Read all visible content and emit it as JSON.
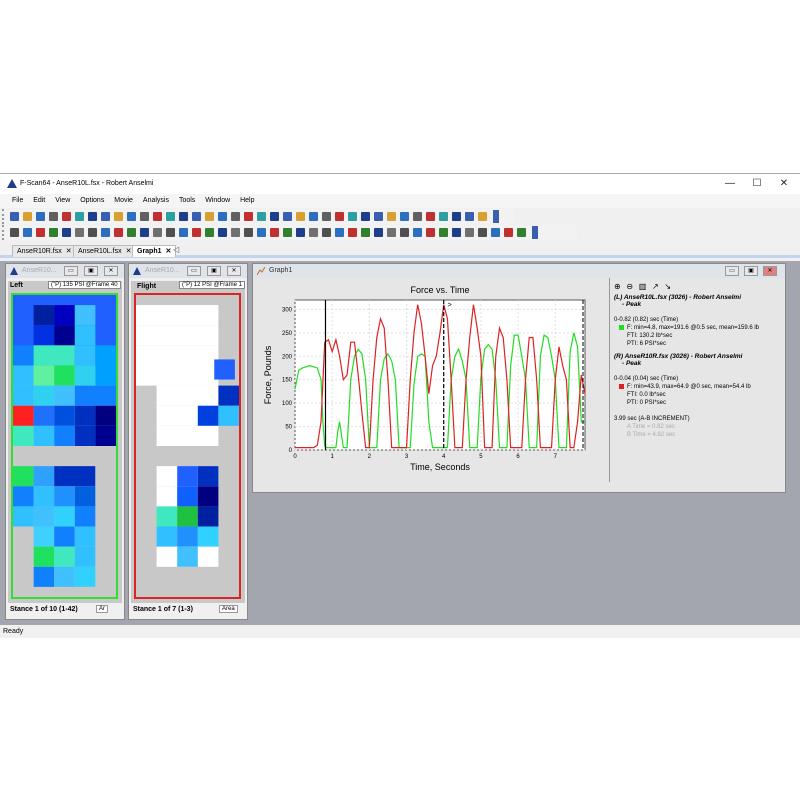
{
  "window": {
    "title": "F-Scan64 - AnseR10L.fsx - Robert  Anselmi",
    "minimize": "—",
    "maximize": "☐",
    "close": "✕"
  },
  "menu": [
    "File",
    "Edit",
    "View",
    "Options",
    "Movie",
    "Analysis",
    "Tools",
    "Window",
    "Help"
  ],
  "tabs": [
    {
      "label": "AnseR10R.fsx",
      "active": false
    },
    {
      "label": "AnseR10L.fsx",
      "active": false
    },
    {
      "label": "Graph1",
      "active": true
    }
  ],
  "left_sensor": {
    "title": "AnseR10...",
    "label": "Left",
    "tag": "(\"P) 135 PSI @Frame 40",
    "stance": "Stance 1 of 10 (1-42)",
    "select": "Ar",
    "border_color": "#33dd33"
  },
  "right_sensor": {
    "title": "AnseR10...",
    "label": "Flight",
    "tag": "(\"P) 12 PSI @Frame 1",
    "stance": "Stance 1 of 7 (1-3)",
    "select": "Area",
    "border_color": "#dd2222"
  },
  "graph_window": {
    "title": "Graph1"
  },
  "legend": {
    "left_head": "(L) AnseR10L.fsx (3026) - Robert  Anselmi",
    "left_head2": "- Peak",
    "left_range": "0-0.82 (0.82) sec (Time)",
    "left_f": "F: min=4.8, max=191.6 @0.5 sec, mean=159.6 lb",
    "left_fti": "FTI: 130.2 lb*sec",
    "left_pti": "PTI: 6 PSI*sec",
    "right_head": "(R) AnseR10R.fsx (3026) - Robert  Anselmi",
    "right_head2": "- Peak",
    "right_range": "0-0.04 (0.04) sec (Time)",
    "right_f": "F: min=43.9, max=64.9 @0 sec, mean=54.4 lb",
    "right_fti": "FTI: 0.0 lb*sec",
    "right_pti": "PTI: 0 PSI*sec",
    "increment": "3.99 sec (A-B INCREMENT)",
    "faded1": "A Time = 0.82 sec",
    "faded2": "B Time = 4.82 sec"
  },
  "status": "Ready",
  "chart_data": {
    "type": "line",
    "title": "Force vs. Time",
    "xlabel": "Time, Seconds",
    "ylabel": "Force, Pounds",
    "xlim": [
      0,
      7.8
    ],
    "ylim": [
      0,
      320
    ],
    "xticks": [
      0,
      1,
      2,
      3,
      4,
      5,
      6,
      7
    ],
    "yticks": [
      0,
      50,
      100,
      150,
      200,
      250,
      300
    ],
    "grid": true,
    "cursors": [
      0.82,
      4.0
    ],
    "cursor_label": ">",
    "series": [
      {
        "color": "#22dd22",
        "x": [
          0,
          0.1,
          0.2,
          0.4,
          0.6,
          0.7,
          0.75,
          0.8,
          0.85,
          1.0,
          1.1,
          1.15,
          1.2,
          1.3,
          1.4,
          1.5,
          1.6,
          1.7,
          1.8,
          1.9,
          2.0,
          2.1,
          2.2,
          2.3,
          2.4,
          2.5,
          2.6,
          2.7,
          2.8,
          2.9,
          3.0,
          3.1,
          3.2,
          3.3,
          3.4,
          3.5,
          3.6,
          3.7,
          3.8,
          3.9,
          4.0,
          4.1,
          4.2,
          4.3,
          4.4,
          4.5,
          4.6,
          4.7,
          4.8,
          4.9,
          5.0,
          5.1,
          5.2,
          5.3,
          5.4,
          5.5,
          5.6,
          5.7,
          5.8,
          5.9,
          6.0,
          6.1,
          6.2,
          6.3,
          6.4,
          6.5,
          6.6,
          6.7,
          6.8,
          6.9,
          7.0,
          7.1,
          7.2,
          7.3,
          7.4,
          7.5,
          7.6,
          7.7,
          7.8
        ],
        "y": [
          130,
          170,
          175,
          180,
          175,
          150,
          60,
          8,
          5,
          5,
          5,
          40,
          60,
          5,
          5,
          150,
          200,
          215,
          205,
          150,
          5,
          5,
          5,
          150,
          195,
          205,
          190,
          150,
          5,
          5,
          5,
          5,
          140,
          200,
          205,
          200,
          60,
          5,
          5,
          5,
          5,
          5,
          150,
          200,
          215,
          190,
          150,
          5,
          5,
          5,
          155,
          215,
          225,
          215,
          150,
          5,
          5,
          5,
          180,
          245,
          245,
          200,
          150,
          5,
          5,
          5,
          200,
          245,
          240,
          200,
          150,
          5,
          5,
          5,
          210,
          250,
          220,
          60,
          60
        ]
      },
      {
        "color": "#dd2222",
        "x": [
          0,
          0.2,
          0.3,
          0.5,
          0.6,
          0.7,
          0.8,
          0.9,
          1.0,
          1.1,
          1.2,
          1.3,
          1.4,
          1.5,
          1.6,
          1.7,
          1.8,
          1.9,
          2.0,
          2.1,
          2.2,
          2.3,
          2.4,
          2.5,
          2.6,
          2.7,
          2.8,
          2.9,
          3.0,
          3.1,
          3.2,
          3.3,
          3.4,
          3.5,
          3.6,
          3.7,
          3.8,
          3.9,
          4.0,
          4.1,
          4.2,
          4.3,
          4.4,
          4.5,
          4.6,
          4.7,
          4.8,
          4.9,
          5.0,
          5.1,
          5.2,
          5.3,
          5.4,
          5.5,
          5.6,
          5.7,
          5.8,
          5.9,
          6.0,
          6.1,
          6.2,
          6.3,
          6.4,
          6.5,
          6.6,
          6.7,
          6.8,
          6.9,
          7.0,
          7.1,
          7.2,
          7.3,
          7.4,
          7.5,
          7.6,
          7.7,
          7.8
        ],
        "y": [
          5,
          5,
          5,
          5,
          10,
          60,
          230,
          235,
          210,
          235,
          200,
          150,
          160,
          230,
          230,
          160,
          80,
          5,
          5,
          150,
          240,
          280,
          260,
          150,
          5,
          5,
          5,
          5,
          5,
          150,
          250,
          310,
          270,
          200,
          120,
          180,
          200,
          250,
          310,
          280,
          150,
          5,
          5,
          5,
          150,
          240,
          310,
          260,
          200,
          5,
          5,
          5,
          200,
          260,
          240,
          150,
          5,
          5,
          5,
          5,
          150,
          240,
          240,
          150,
          5,
          5,
          5,
          5,
          150,
          220,
          180,
          150,
          5,
          5,
          60,
          160,
          120
        ]
      }
    ]
  }
}
